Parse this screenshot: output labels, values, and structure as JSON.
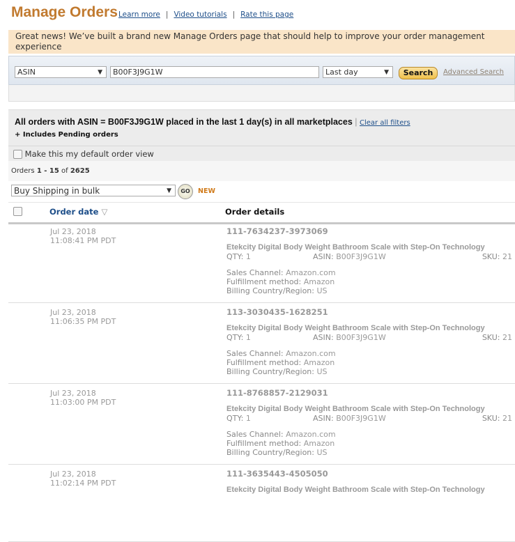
{
  "header": {
    "title": "Manage Orders",
    "links": [
      "Learn more",
      "Video tutorials",
      "Rate this page"
    ]
  },
  "banner": "Great news! We’ve built a brand new Manage Orders page that should help to improve your order management experience",
  "search": {
    "field": "ASIN",
    "query": "B00F3J9G1W",
    "range": "Last day",
    "button": "Search",
    "advanced": "Advanced Search"
  },
  "filter": {
    "heading": "All orders with ASIN = B00F3J9G1W placed in the last 1 day(s) in all marketplaces",
    "clear": "Clear all filters",
    "pending": "+ Includes Pending orders",
    "default_view": "Make this my default order view"
  },
  "count": {
    "prefix": "Orders",
    "range": "1 - 15",
    "of": "of",
    "total": "2625"
  },
  "bulk": {
    "action": "Buy Shipping in bulk",
    "go": "GO",
    "new": "NEW"
  },
  "table": {
    "col_date": "Order date",
    "col_details": "Order details"
  },
  "labels": {
    "qty": "QTY:",
    "asin": "ASIN:",
    "sku": "SKU:",
    "channel": "Sales Channel:",
    "fulfillment": "Fulfillment method:",
    "billing": "Billing Country/Region:"
  },
  "orders": [
    {
      "date": "Jul 23, 2018",
      "time": "11:08:41 PM PDT",
      "id": "111-7634237-3973069",
      "product": "Etekcity Digital Body Weight Bathroom Scale with Step-On Technology",
      "qty": "1",
      "asin": "B00F3J9G1W",
      "sku": "21",
      "channel": "Amazon.com",
      "fulfillment": "Amazon",
      "billing": "US"
    },
    {
      "date": "Jul 23, 2018",
      "time": "11:06:35 PM PDT",
      "id": "113-3030435-1628251",
      "product": "Etekcity Digital Body Weight Bathroom Scale with Step-On Technology",
      "qty": "1",
      "asin": "B00F3J9G1W",
      "sku": "21",
      "channel": "Amazon.com",
      "fulfillment": "Amazon",
      "billing": "US"
    },
    {
      "date": "Jul 23, 2018",
      "time": "11:03:00 PM PDT",
      "id": "111-8768857-2129031",
      "product": "Etekcity Digital Body Weight Bathroom Scale with Step-On Technology",
      "qty": "1",
      "asin": "B00F3J9G1W",
      "sku": "21",
      "channel": "Amazon.com",
      "fulfillment": "Amazon",
      "billing": "US"
    },
    {
      "date": "Jul 23, 2018",
      "time": "11:02:14 PM PDT",
      "id": "111-3635443-4505050",
      "product": "Etekcity Digital Body Weight Bathroom Scale with Step-On Technology"
    }
  ]
}
